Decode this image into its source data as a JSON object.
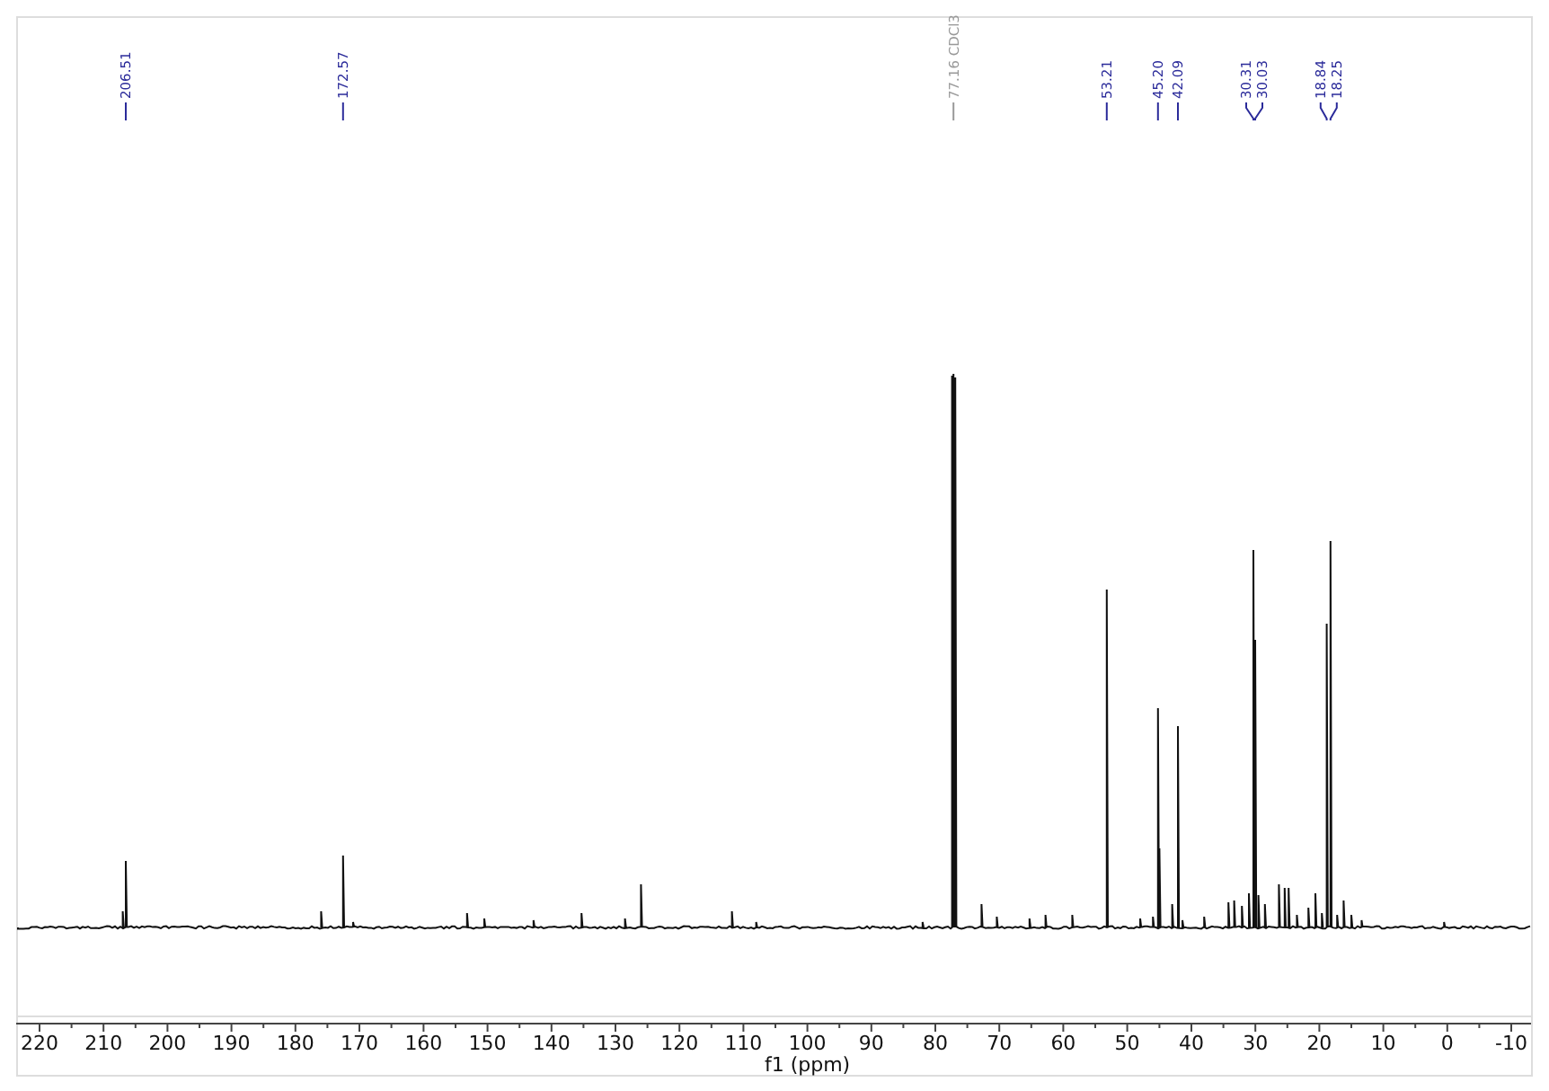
{
  "peak_labels": [
    {
      "text": "206.51",
      "kind": "compound"
    },
    {
      "text": "172.57",
      "kind": "compound"
    },
    {
      "text": "77.16 CDCl3",
      "kind": "solvent"
    },
    {
      "text": "53.21",
      "kind": "compound"
    },
    {
      "text": "45.20",
      "kind": "compound"
    },
    {
      "text": "42.09",
      "kind": "compound"
    },
    {
      "text": "30.31",
      "kind": "compound"
    },
    {
      "text": "30.03",
      "kind": "compound"
    },
    {
      "text": "18.84",
      "kind": "compound"
    },
    {
      "text": "18.25",
      "kind": "compound"
    }
  ],
  "x_axis": {
    "label": "f1 (ppm)",
    "ticks": [
      "220",
      "210",
      "200",
      "190",
      "180",
      "170",
      "160",
      "150",
      "140",
      "130",
      "120",
      "110",
      "100",
      "90",
      "80",
      "70",
      "60",
      "50",
      "40",
      "30",
      "20",
      "10",
      "0",
      "-10"
    ]
  }
}
